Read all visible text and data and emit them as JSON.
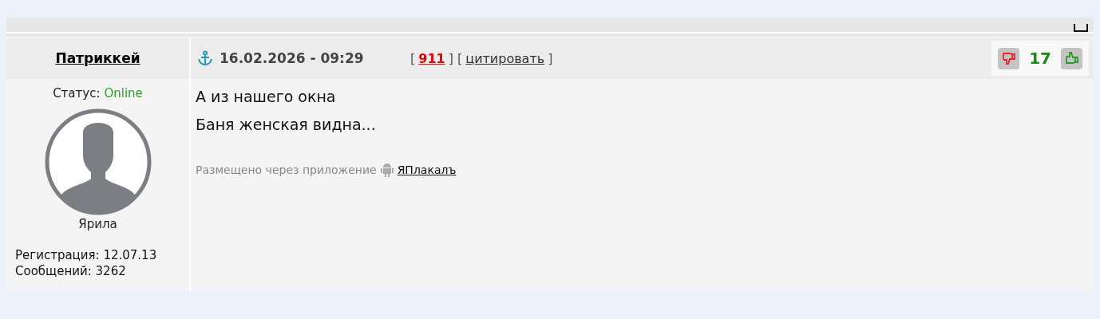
{
  "post": {
    "author": "Патриккей",
    "date": "16.02.2026 - 09:29",
    "number": "911",
    "quote": "цитировать",
    "brackets": [
      "[",
      "] [",
      "]"
    ],
    "rating": "17",
    "status_label": "Статус:",
    "status": "Online",
    "online": true,
    "rank": "Ярила",
    "stats": [
      "Регистрация: 12.07.13",
      "Сообщений: 3262"
    ],
    "lines": [
      "А из нашего окна",
      "Баня женская видна..."
    ],
    "via": "Размещено через приложение",
    "app": "ЯПлакалъ"
  }
}
